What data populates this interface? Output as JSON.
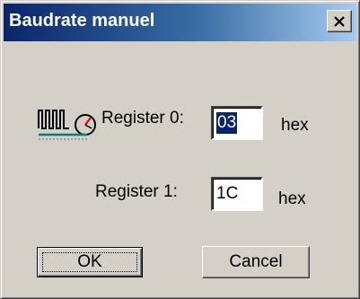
{
  "window": {
    "title": "Baudrate manuel",
    "close_glyph": "✕"
  },
  "registers": [
    {
      "label": "Register 0:",
      "value": "03",
      "unit": "hex",
      "selected": true
    },
    {
      "label": "Register 1:",
      "value": "1C",
      "unit": "hex",
      "selected": false
    }
  ],
  "buttons": {
    "ok_label": "OK",
    "cancel_label": "Cancel"
  },
  "icons": {
    "register_icon": "register-waveform-icon",
    "close_icon": "close-icon"
  },
  "colors": {
    "title_start": "#0a246a",
    "title_end": "#a6caf0",
    "face": "#d4d0c8",
    "selection": "#0a246a"
  }
}
